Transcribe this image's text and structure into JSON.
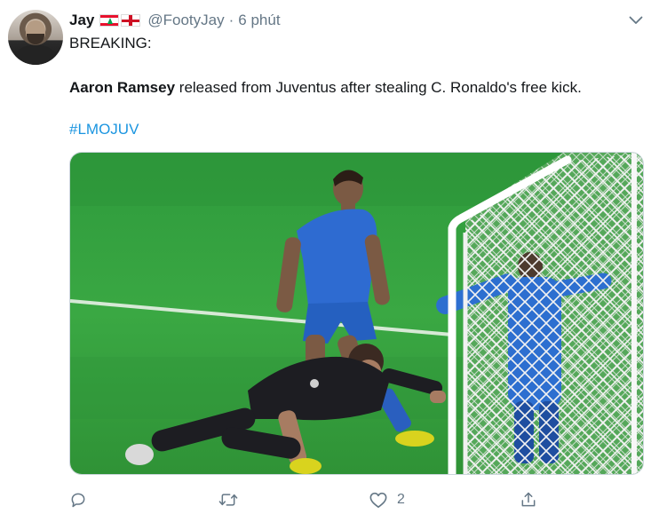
{
  "author": {
    "name": "Jay",
    "handle": "@FootyJay",
    "separator": "·",
    "time": "6 phút"
  },
  "tweet": {
    "line1": "BREAKING:",
    "line2_bold": "Aaron Ramsey",
    "line2_rest": " released from Juventus after stealing C. Ronaldo's free kick.",
    "hashtag": "#LMOJUV"
  },
  "actions": {
    "reply_count": "",
    "retweet_count": "",
    "like_count": "2",
    "share_count": ""
  },
  "icons": {
    "reply": "reply-icon",
    "retweet": "retweet-icon",
    "like": "heart-icon",
    "share": "share-icon",
    "caret": "chevron-down-icon"
  },
  "colors": {
    "text": "#14171a",
    "secondary": "#657786",
    "link": "#1b95e0",
    "pitch": "#2f9a3a",
    "jersey": "#2a63c7"
  }
}
